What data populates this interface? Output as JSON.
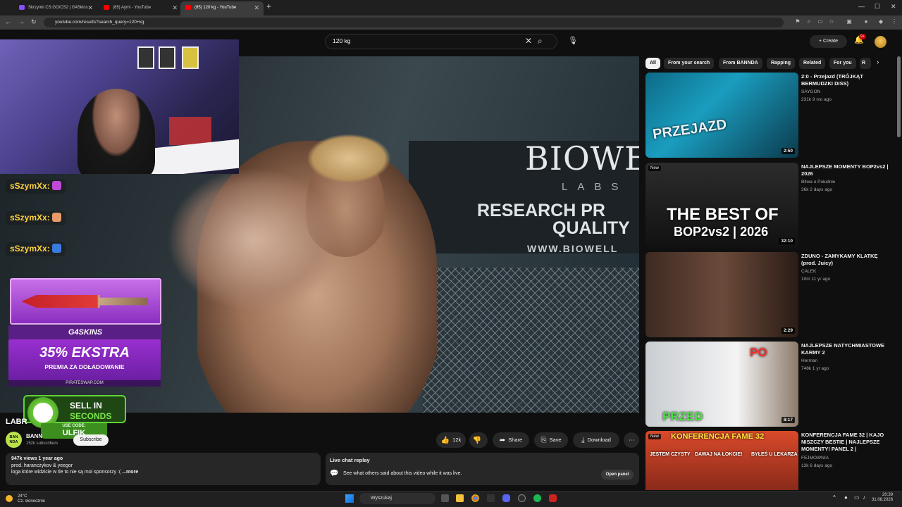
{
  "browser": {
    "tabs": [
      {
        "title": "Skrzynki CS:GO/CS2 | G4Skins",
        "favicon_color": "#8a4fff"
      },
      {
        "title": "(85) Aymi - YouTube",
        "favicon_color": "#ff0000"
      },
      {
        "title": "(85) 120 kg - YouTube",
        "favicon_color": "#ff0000"
      }
    ],
    "url": "youtube.com/results?search_query=120+kg"
  },
  "header": {
    "search_value": "120 kg",
    "create_label": "Create",
    "notification_count": "9+"
  },
  "chips": [
    "All",
    "From your search",
    "From BANNDA",
    "Rapping",
    "Related",
    "For you",
    "R"
  ],
  "overlay": {
    "chat_lines": [
      "sSzymXx:",
      "sSzymXx:",
      "sSzymXx:"
    ],
    "g4_logo": "G4SKINS",
    "promo_big": "35% EKSTRA",
    "promo_small": "PREMIA ZA DOŁADOWANIE",
    "promo_url": "PIRATESWAP.COM",
    "sell_line1": "SELL IN",
    "sell_line2": "SECONDS",
    "use_code_label": "USE CODE:",
    "use_code": "ULFIK"
  },
  "video_banner": {
    "line1": "BIOWELL",
    "line2": "LABS",
    "line3": "RESEARCH PR",
    "line4": "QUALITY",
    "line5": "WWW.BIOWELL"
  },
  "video": {
    "title": "LABR",
    "channel_name": "BANN",
    "channel_avatar_text": "BAN NDA",
    "subscribers": "152k subscribers",
    "subscribe_label": "Subscribe",
    "likes": "12k",
    "share_label": "Share",
    "save_label": "Save",
    "download_label": "Download",
    "views_date": "947k views  1 year ago",
    "desc_line1": "prod. harancżykov & yeegor",
    "desc_line2": "loga które widzicie w tle to nie są moi sponsorzy :(",
    "more_label": "...more"
  },
  "live_chat": {
    "title": "Live chat replay",
    "subtitle": "See what others said about this video while it was live.",
    "open_label": "Open panel"
  },
  "recommendations": [
    {
      "title": "2:0 - Przejazd (TRÓJKĄT BERMUDZKI DISS)",
      "channel": "SAYGON",
      "meta": "231k  9 mo ago",
      "duration": "2:50",
      "caption": "PRZEJAZD",
      "is_new": false
    },
    {
      "title": "NAJLEPSZE MOMENTY BOP2vs2 | 2026",
      "channel": "Bitwa o Południe",
      "meta": "36k  2 days ago",
      "duration": "32:10",
      "caption": "THE BEST OF",
      "caption2": "BOP2vs2 | 2026",
      "is_new": true
    },
    {
      "title": "ZDUNO - ZAMYKAMY KLATKĘ (prod. Juicy)",
      "channel": "CALEK",
      "meta": "10m  11 yr ago",
      "duration": "2:29",
      "is_new": false
    },
    {
      "title": "NAJLEPSZE NATYCHMIASTOWE KARMY 2",
      "channel": "Herman",
      "meta": "748k  1 yr ago",
      "duration": "8:17",
      "caption": "PRZED",
      "caption2": "PO",
      "is_new": false
    },
    {
      "title": "KONFERENCJA FAME 32 | KAJO NISZCZY BESTIE | NAJLEPSZE MOMENTY! PANEL 2 |",
      "channel": "FEJMOWNIA",
      "meta": "13k  6 days ago",
      "caption": "KONFERENCJA FAME 32",
      "caption2": "JESTEM CZYSTY",
      "caption3": "DAWAJ NA ŁOKCIE!",
      "caption4": "BYŁEŚ U LEKARZA",
      "is_new": true
    }
  ],
  "taskbar": {
    "temperature": "24°C",
    "weather": "Cz. słonecznie",
    "search_placeholder": "Wyszukaj",
    "time": "20:39",
    "date": "31.08.2026"
  },
  "colors": {
    "youtube_red": "#ff0000",
    "g4_purple": "#8a2fc0",
    "chat_yellow": "#ffd23f",
    "sell_green": "#61d436"
  }
}
